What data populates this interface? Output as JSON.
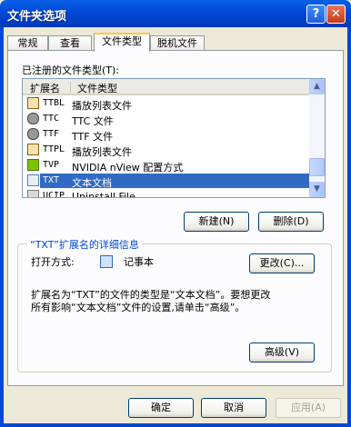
{
  "window": {
    "title": "文件夹选项",
    "help_glyph": "?",
    "close_glyph": "✕"
  },
  "tabs": [
    {
      "label": "常规",
      "active": false
    },
    {
      "label": "查看",
      "active": false
    },
    {
      "label": "文件类型",
      "active": true
    },
    {
      "label": "脱机文件",
      "active": false
    }
  ],
  "registered_label": "已注册的文件类型(T):",
  "list": {
    "columns": [
      "扩展名",
      "文件类型"
    ],
    "rows": [
      {
        "ext": "TTBL",
        "type": "播放列表文件",
        "icon": "playlist-icon",
        "selected": false
      },
      {
        "ext": "TTC",
        "type": "TTC 文件",
        "icon": "font-icon",
        "selected": false
      },
      {
        "ext": "TTF",
        "type": "TTF 文件",
        "icon": "font-icon",
        "selected": false
      },
      {
        "ext": "TTPL",
        "type": "播放列表文件",
        "icon": "playlist-icon",
        "selected": false
      },
      {
        "ext": "TVP",
        "type": "NVIDIA nView 配置方式",
        "icon": "nview-icon",
        "selected": false
      },
      {
        "ext": "TXT",
        "type": "文本文档",
        "icon": "text-doc-icon",
        "selected": true
      },
      {
        "ext": "UCIP",
        "type": "Uninstall File",
        "icon": "generic-file-icon",
        "selected": false
      }
    ]
  },
  "buttons": {
    "new": "新建(N)",
    "delete": "删除(D)",
    "change": "更改(C)...",
    "advanced": "高级(V)",
    "ok": "确定",
    "cancel": "取消",
    "apply": "应用(A)"
  },
  "details": {
    "title": "“TXT”扩展名的详细信息",
    "opens_with_label": "打开方式:",
    "opens_with_app": "记事本",
    "description_line1": "扩展名为“TXT”的文件的类型是“文本文档”。要想更改",
    "description_line2": "所有影响“文本文档”文件的设置,请单击“高级”。"
  },
  "colors": {
    "title_bar": "#0048D8",
    "selection": "#316AC5",
    "group_title": "#0046D5"
  }
}
